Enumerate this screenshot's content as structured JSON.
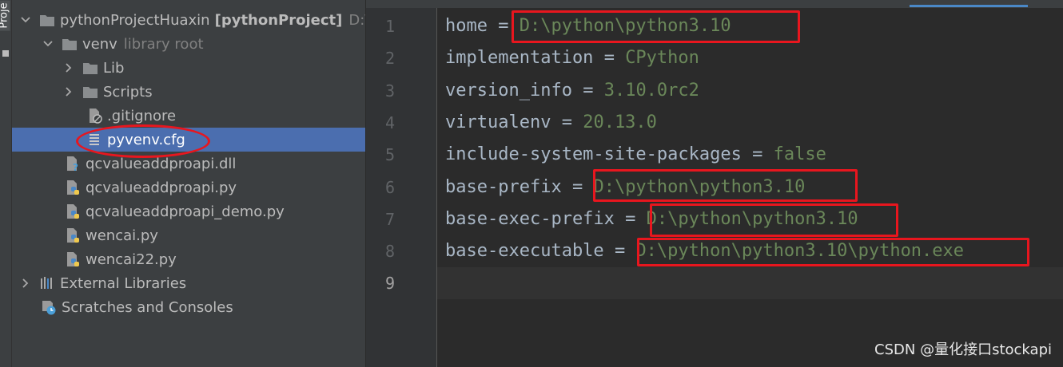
{
  "tool_window": {
    "label": "Proje"
  },
  "tree": {
    "root": {
      "name": "pythonProjectHuaxin",
      "module": "[pythonProject]",
      "path": "D:\\py"
    },
    "venv": {
      "name": "venv",
      "hint": "library root"
    },
    "items": {
      "lib": "Lib",
      "scripts": "Scripts",
      "gitignore": ".gitignore",
      "pyvenv": "pyvenv.cfg",
      "dll": "qcvalueaddproapi.dll",
      "py": "qcvalueaddproapi.py",
      "demo": "qcvalueaddproapi_demo.py",
      "wencai": "wencai.py",
      "wencai22": "wencai22.py",
      "external": "External Libraries",
      "scratches": "Scratches and Consoles"
    }
  },
  "editor": {
    "line_numbers": [
      "1",
      "2",
      "3",
      "4",
      "5",
      "6",
      "7",
      "8",
      "9"
    ],
    "lines": [
      {
        "key": "home",
        "value": "D:\\python\\python3.10"
      },
      {
        "key": "implementation",
        "value": "CPython"
      },
      {
        "key": "version_info",
        "value": "3.10.0rc2"
      },
      {
        "key": "virtualenv",
        "value": "20.13.0"
      },
      {
        "key": "include-system-site-packages",
        "value": "false"
      },
      {
        "key": "base-prefix",
        "value": "D:\\python\\python3.10"
      },
      {
        "key": "base-exec-prefix",
        "value": "D:\\python\\python3.10"
      },
      {
        "key": "base-executable",
        "value": "D:\\python\\python3.10\\python.exe"
      }
    ],
    "equals": "="
  },
  "watermark": "CSDN @量化接口stockapi",
  "colors": {
    "highlight": "#e8161e",
    "selection": "#4b6eaf",
    "value": "#6a8759",
    "key": "#a9b7c6"
  }
}
